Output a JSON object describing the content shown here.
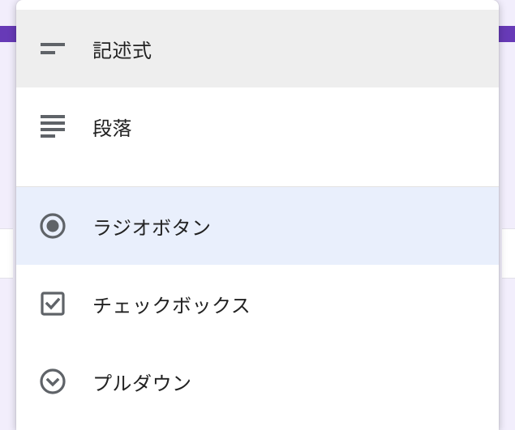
{
  "menu": {
    "items": [
      {
        "id": "short-answer",
        "label": "記述式",
        "icon": "short-text-icon",
        "state": "hover"
      },
      {
        "id": "paragraph",
        "label": "段落",
        "icon": "paragraph-icon",
        "state": "normal"
      },
      {
        "id": "radio",
        "label": "ラジオボタン",
        "icon": "radio-icon",
        "state": "selected"
      },
      {
        "id": "checkbox",
        "label": "チェックボックス",
        "icon": "checkbox-icon",
        "state": "normal"
      },
      {
        "id": "dropdown",
        "label": "プルダウン",
        "icon": "dropdown-icon",
        "state": "normal"
      }
    ]
  }
}
